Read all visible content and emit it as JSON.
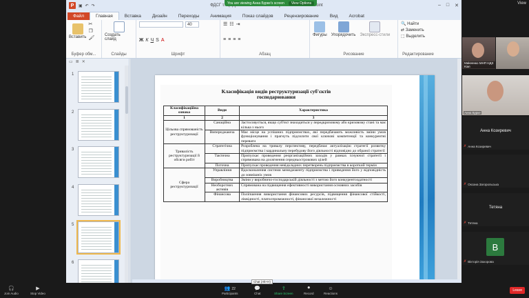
{
  "zoom": {
    "share_banner": "You are viewing Анна Бурке's screen",
    "view_options": "View Options",
    "view": "View",
    "toolbar": {
      "join_audio": "Join Audio",
      "stop_video": "Stop Video",
      "participants": "Participants",
      "participants_count": "22",
      "chat": "Chat",
      "share_screen": "Share Screen",
      "record": "Record",
      "reactions": "Reactions",
      "leave": "Leave",
      "chat_tooltip": "Chat (Alt+H)"
    },
    "participants": [
      {
        "name": "Маkеенко МНП НДЗ Кіап",
        "type": "video"
      },
      {
        "name": "Анна Бурке",
        "type": "video"
      },
      {
        "name": "Анна Козиревич",
        "label": "Анна Козиревич",
        "muted": true
      },
      {
        "name": "",
        "label": "Оксана Загорольська",
        "muted": true
      },
      {
        "name": "Тетяна",
        "label": "Тетяна",
        "muted": true
      },
      {
        "name": "B",
        "label": "Вікторія Захорова",
        "muted": true,
        "avatar": true
      }
    ]
  },
  "ppt": {
    "title": "ФДСГ т.7 (3) [Режим совместимости] - Microsoft PowerPoint",
    "tabs": [
      "Файл",
      "Главная",
      "Вставка",
      "Дизайн",
      "Переходы",
      "Анимация",
      "Показ слайдов",
      "Рецензирование",
      "Вид",
      "Acrobat"
    ],
    "active_tab": "Главная",
    "ribbon": {
      "paste": "Вставить",
      "create_slide": "Создать слайд",
      "clipboard": "Буфер обм...",
      "slides": "Слайды",
      "font": "Шрифт",
      "paragraph": "Абзац",
      "drawing": "Рисование",
      "editing": "Редактирование",
      "shapes": "Фигуры",
      "arrange": "Упорядочить",
      "express_styles": "Экспресс-стили",
      "find": "Найти",
      "replace": "Заменить",
      "select": "Выделить",
      "font_size": "40"
    },
    "thumb_numbers": [
      "1",
      "2",
      "3",
      "4",
      "5",
      "6"
    ],
    "selected_thumb": "5",
    "slide": {
      "title_line1": "Класифікація видів реструктуризації суб'єктів",
      "title_line2": "господарювання",
      "headers": [
        "Класифікаційна ознака",
        "Види",
        "Характеристика"
      ],
      "header_nums": [
        "1",
        "2",
        "3"
      ],
      "groups": [
        {
          "sign": "Цільова спрямованість реструктуризації",
          "rows": [
            {
              "type": "Санаційна",
              "desc": "Застосовується, якщо суб'єкт знаходиться у передкризовому або кризовому стані та має кілька з нього"
            },
            {
              "type": "Випереджаюча",
              "desc": "Має місце на успішних підприємствах, які передбачають можливість зміни умов функціонування і прагнуть підсилити свої ключові компетенції та конкурентні переваги"
            }
          ]
        },
        {
          "sign": "Тривалість реструктуризації й обсяги робіт",
          "rows": [
            {
              "type": "Стратегічна",
              "desc": "Розроблена на тривалу перспективу, передбачає актуалізацію стратегії розвитку підприємства і кардинальну перебудову його діяльності відповідно до обраної стратегії"
            },
            {
              "type": "Тактична",
              "desc": "Припускає проведення реорганізаційних заходів у рамках існуючої стратегії і спрямована на досягнення середньострокових цілей"
            },
            {
              "type": "Поточна",
              "desc": "Припускає проведення невідкладних перетворень підприємства в короткий термін"
            }
          ]
        },
        {
          "sign": "Сфера реструктуризації",
          "rows": [
            {
              "type": "Управління",
              "desc": "Вдосконалення системи менеджменту підприємства і приведення його у відповідність до зовнішніх умов"
            },
            {
              "type": "Виробництва",
              "desc": "Зміни у виробничо-господарській діяльності з метою його конкурентоздатності"
            },
            {
              "type": "Необоротних активів",
              "desc": "Спрямована на підвищення ефективності використання основних засобів"
            },
            {
              "type": "Фінансова",
              "desc": "Поліпшення використання фінансових ресурсів, підвищення фінансової стійкості, ліквідності, платоспроможності, фінансової незалежності"
            }
          ]
        }
      ]
    }
  }
}
